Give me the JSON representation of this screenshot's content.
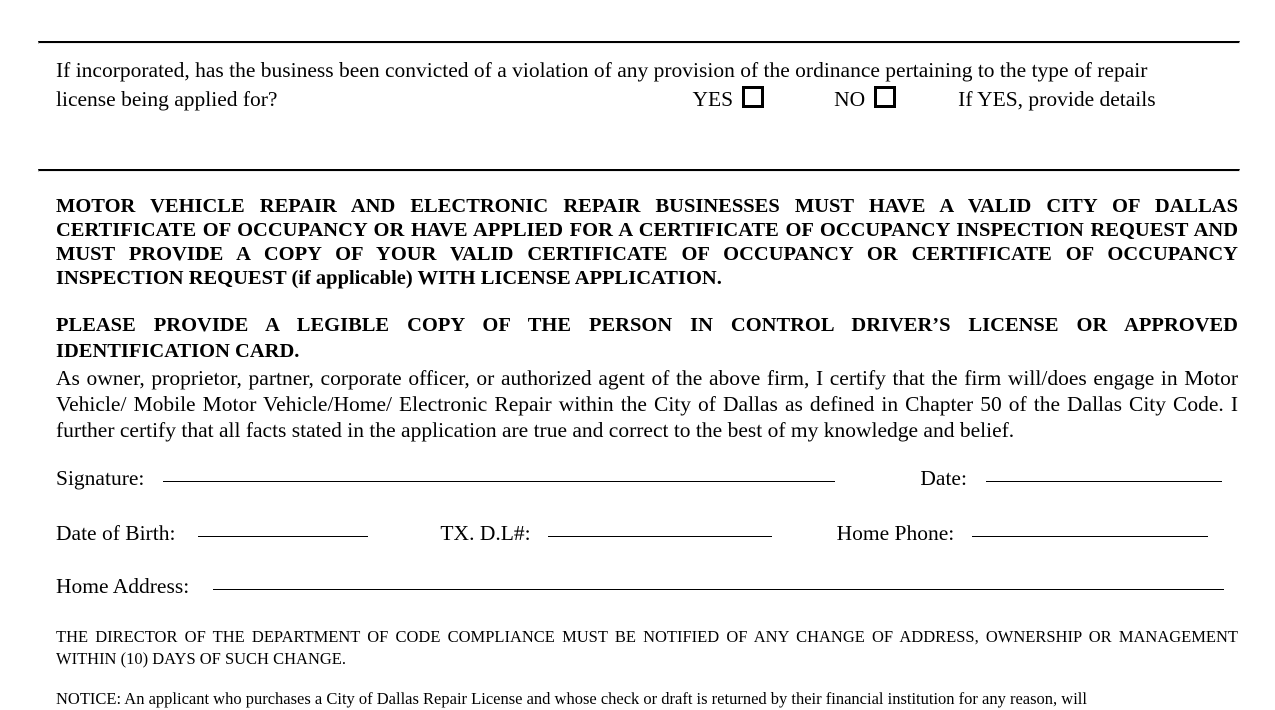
{
  "form": {
    "incorporation_question": {
      "line1": "If incorporated, has the business been convicted of a violation of any provision of the ordinance pertaining to the type of repair",
      "line2": "license being applied for?",
      "yes_label": "YES",
      "no_label": "NO",
      "details_label": "If YES, provide details"
    },
    "certificate_notice": "MOTOR VEHICLE REPAIR AND ELECTRONIC REPAIR BUSINESSES MUST HAVE A VALID CITY OF DALLAS CERTIFICATE OF OCCUPANCY OR HAVE APPLIED FOR A CERTIFICATE OF OCCUPANCY INSPECTION REQUEST AND MUST PROVIDE A COPY OF YOUR VALID CERTIFICATE OF OCCUPANCY OR CERTIFICATE OF OCCUPANCY INSPECTION REQUEST (if applicable) WITH LICENSE APPLICATION.",
    "legible_copy_notice": "PLEASE PROVIDE A LEGIBLE COPY OF THE PERSON IN CONTROL DRIVER’S LICENSE OR APPROVED IDENTIFICATION CARD.",
    "certification_paragraph": "As owner, proprietor, partner, corporate officer, or authorized agent of the above firm, I certify that the firm will/does engage in Motor Vehicle/ Mobile Motor Vehicle/Home/ Electronic Repair within the City of Dallas as defined in Chapter 50 of the Dallas City Code.  I further certify that all facts stated in the application are true and correct to the best of my knowledge and belief.",
    "fields": {
      "signature_label": "Signature:",
      "date_label": "Date:",
      "date_of_birth_label": "Date of Birth:",
      "drivers_license_label": "TX. D.L#:",
      "home_phone_label": "Home Phone:",
      "home_address_label": "Home Address:",
      "signature_value": "",
      "date_value": "",
      "date_of_birth_value": "",
      "drivers_license_value": "",
      "home_phone_value": "",
      "home_address_value": ""
    },
    "director_notice": "THE DIRECTOR OF THE DEPARTMENT OF CODE COMPLIANCE MUST BE NOTIFIED OF ANY CHANGE OF ADDRESS, OWNERSHIP OR MANAGEMENT WITHIN (10) DAYS OF SUCH CHANGE.",
    "returned_check_notice": "NOTICE: An applicant who purchases a City of Dallas Repair License and whose check or draft is returned by their financial institution for any reason, will"
  },
  "colors": {
    "text": "#000000",
    "rule": "#000000",
    "background": "#ffffff"
  }
}
